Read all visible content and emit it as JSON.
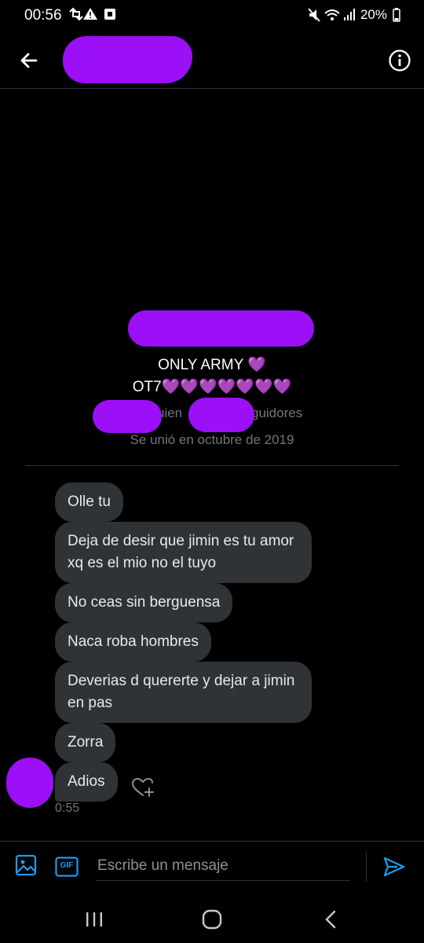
{
  "status_bar": {
    "time": "00:56",
    "battery": "20%"
  },
  "profile": {
    "bio_line1": "ONLY ARMY 💜",
    "bio_line2": "OT7💜💜💜💜💜💜💜",
    "following_fragment": "uien",
    "followers_fragment": "guidores",
    "joined": "Se unió en octubre de 2019"
  },
  "messages": [
    {
      "text": "Olle tu"
    },
    {
      "text": "Deja de desir que jimin es tu amor  xq es el mio no el tuyo"
    },
    {
      "text": "No ceas sin berguensa"
    },
    {
      "text": "Naca roba hombres"
    },
    {
      "text": "Deverias d quererte y dejar a jimin en pas"
    },
    {
      "text": "Zorra"
    },
    {
      "text": "Adios"
    }
  ],
  "last_message_time": "0:55",
  "composer": {
    "placeholder": "Escribe un mensaje",
    "gif_label": "GIF"
  },
  "colors": {
    "accent": "#1d9bf0",
    "redaction": "#9b10f6",
    "bubble": "#2f3336"
  },
  "icons": [
    "back-arrow-icon",
    "info-icon",
    "image-icon",
    "gif-icon",
    "send-icon",
    "heart-plus-icon"
  ]
}
